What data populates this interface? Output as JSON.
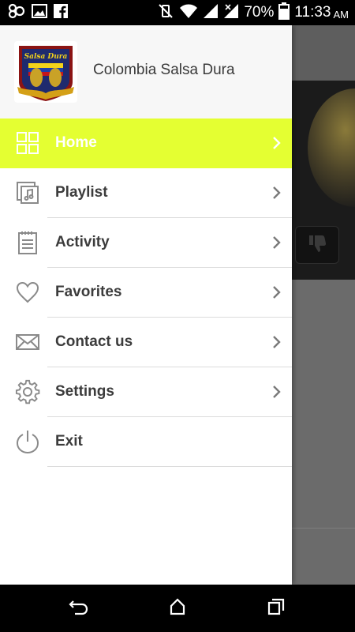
{
  "status_bar": {
    "battery_percent": "70%",
    "time": "11:33",
    "ampm": "AM"
  },
  "drawer": {
    "app_name": "Colombia Salsa Dura",
    "logo_text": "Colombia Salsa Dura"
  },
  "menu": {
    "items": [
      {
        "label": "Home",
        "icon": "grid-icon",
        "active": true,
        "has_chevron": true
      },
      {
        "label": "Playlist",
        "icon": "playlist-icon",
        "active": false,
        "has_chevron": true
      },
      {
        "label": "Activity",
        "icon": "notepad-icon",
        "active": false,
        "has_chevron": true
      },
      {
        "label": "Favorites",
        "icon": "heart-icon",
        "active": false,
        "has_chevron": true
      },
      {
        "label": "Contact us",
        "icon": "envelope-icon",
        "active": false,
        "has_chevron": true
      },
      {
        "label": "Settings",
        "icon": "gear-icon",
        "active": false,
        "has_chevron": true
      },
      {
        "label": "Exit",
        "icon": "power-icon",
        "active": false,
        "has_chevron": false
      }
    ]
  },
  "colors": {
    "active_item": "#e4ff32",
    "label_text": "#3c3c3c",
    "icon_gray": "#8a8a8a"
  }
}
